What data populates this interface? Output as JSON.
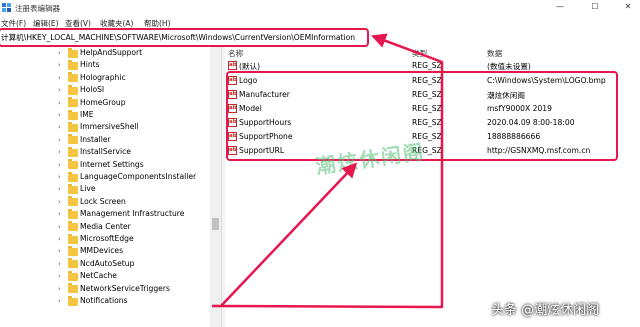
{
  "window": {
    "title": "注册表编辑器",
    "min_glyph": "—",
    "max_glyph": "☐",
    "close_glyph": "✕"
  },
  "menu": [
    "文件(F)",
    "编辑(E)",
    "查看(V)",
    "收藏夹(A)",
    "帮助(H)"
  ],
  "address": {
    "path": "计算机\\HKEY_LOCAL_MACHINE\\SOFTWARE\\Microsoft\\Windows\\CurrentVersion\\OEMInformation"
  },
  "tree": {
    "items": [
      "HelpAndSupport",
      "Hints",
      "Holographic",
      "HoloSI",
      "HomeGroup",
      "IME",
      "ImmersiveShell",
      "Installer",
      "InstallService",
      "Internet Settings",
      "LanguageComponentsInstaller",
      "Live",
      "Lock Screen",
      "Management Infrastructure",
      "Media Center",
      "MicrosoftEdge",
      "MMDevices",
      "NcdAutoSetup",
      "NetCache",
      "NetworkServiceTriggers",
      "Notifications"
    ],
    "chevron_glyph": "›"
  },
  "values_pane": {
    "headers": {
      "name": "名称",
      "type": "类型",
      "data": "数据"
    },
    "rows": [
      {
        "name": "(默认)",
        "type": "REG_SZ",
        "data": "(数值未设置)"
      },
      {
        "name": "Logo",
        "type": "REG_SZ",
        "data": "C:\\Windows\\System\\LOGO.bmp"
      },
      {
        "name": "Manufacturer",
        "type": "REG_SZ",
        "data": "潮炫休闲阁"
      },
      {
        "name": "Model",
        "type": "REG_SZ",
        "data": "msfY9000X 2019"
      },
      {
        "name": "SupportHours",
        "type": "REG_SZ",
        "data": "2020.04.09 8:00-18:00"
      },
      {
        "name": "SupportPhone",
        "type": "REG_SZ",
        "data": "18888886666"
      },
      {
        "name": "SupportURL",
        "type": "REG_SZ",
        "data": "http://GSNXMQ.msf.com.cn"
      }
    ],
    "value_icon_text": "ab"
  },
  "watermark": "潮炫休闲阁",
  "credit": "头条 @潮炫休闲阁",
  "colors": {
    "highlight": "#e6174f",
    "watermark": "#58be7a",
    "folder": "#f5c542"
  }
}
